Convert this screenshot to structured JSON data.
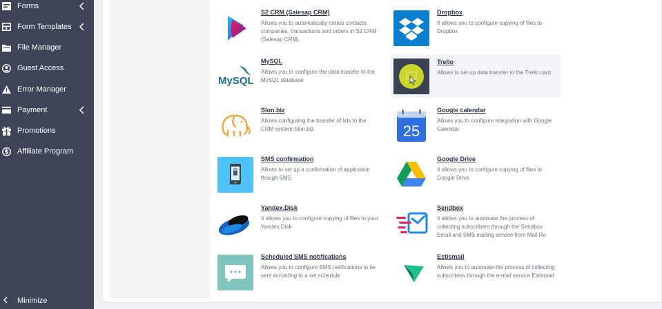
{
  "sidebar": {
    "items": [
      {
        "label": "Forms",
        "icon": "forms-icon",
        "has_submenu": true
      },
      {
        "label": "Form Templates",
        "icon": "form-templates-icon",
        "has_submenu": true
      },
      {
        "label": "File Manager",
        "icon": "file-manager-icon",
        "has_submenu": false
      },
      {
        "label": "Guest Access",
        "icon": "guest-access-icon",
        "has_submenu": false
      },
      {
        "label": "Error Manager",
        "icon": "error-manager-icon",
        "has_submenu": false
      },
      {
        "label": "Payment",
        "icon": "payment-icon",
        "has_submenu": true
      },
      {
        "label": "Promotions",
        "icon": "gift-icon",
        "has_submenu": false
      },
      {
        "label": "Affiliate Program",
        "icon": "dollar-icon",
        "has_submenu": false
      }
    ],
    "minimize_label": "Minimize"
  },
  "integrations": [
    {
      "title": "S2 CRM (Salesap CRM)",
      "desc": "Allows you to automatically create contacts, companies, transactions and orders in S2 CRM (Salesap CRM).",
      "icon": "s2-crm-logo"
    },
    {
      "title": "Dropbox",
      "desc": "It allows you to configure copying of files to Dropbox",
      "icon": "dropbox-logo"
    },
    {
      "title": "MySQL",
      "desc": "Allows you to configure the data transfer to the MySQL database",
      "icon": "mysql-logo",
      "logo_text": "MySQL"
    },
    {
      "title": "Trello",
      "desc": "Allows to set up data transfer to the Trello card",
      "icon": "trello-logo"
    },
    {
      "title": "Slon.biz",
      "desc": "Allows configuring the transfer of lids to the CRM system Slon.biz",
      "icon": "elephant-logo"
    },
    {
      "title": "Google calendar",
      "desc": "Allows you to configure integration with Google Calendar.",
      "icon": "google-calendar-logo",
      "logo_text": "25"
    },
    {
      "title": "SMS confirmation",
      "desc": "Allows to set up a confirmation of application though SMS",
      "icon": "sms-confirmation-logo"
    },
    {
      "title": "Google Drive",
      "desc": "It allows you to configure copying of files to Google Drive",
      "icon": "google-drive-logo"
    },
    {
      "title": "Yandex.Disk",
      "desc": "It allows you to configure copying of files to your Yandex.Disk",
      "icon": "yandex-disk-logo"
    },
    {
      "title": "Sendbox",
      "desc": "It allows you to automate the process of collecting subscribers through the Sendbox Email and SMS mailing service from Mail.Ru Group",
      "icon": "sendbox-logo"
    },
    {
      "title": "Scheduled SMS notifications",
      "desc": "Allows you to configure SMS notifications to be sent according to a set schedule",
      "icon": "sms-notification-logo"
    },
    {
      "title": "Estismail",
      "desc": "Allows you to automate the process of collecting subscribers through the e-mail service Estismail",
      "icon": "estismail-logo"
    }
  ],
  "colors": {
    "sidebar_bg": "#3d4457",
    "title": "#2c3348",
    "desc": "#6b7180",
    "dropbox": "#0a7fd0",
    "sms_bg": "#4fc3f7",
    "teal_bg": "#7fc4bd"
  }
}
